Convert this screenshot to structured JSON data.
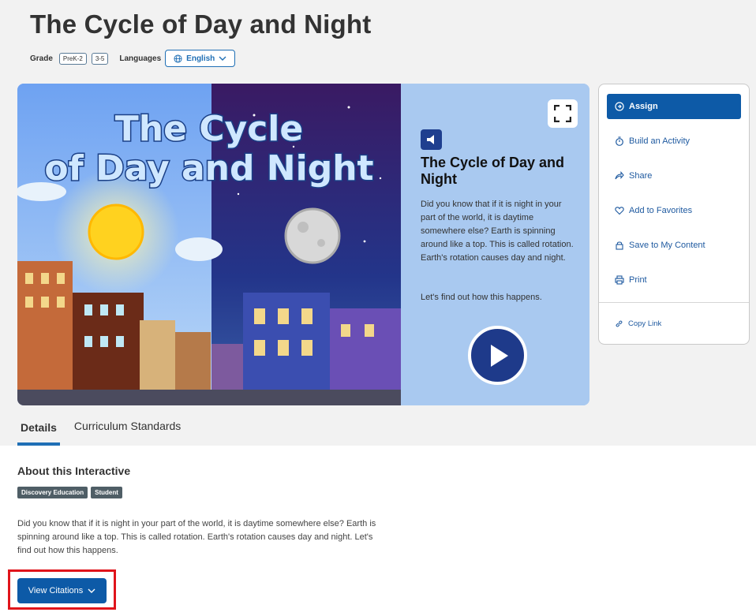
{
  "page": {
    "title": "The Cycle of Day and Night"
  },
  "meta": {
    "grade_label": "Grade",
    "grades": [
      "PreK-2",
      "3-5"
    ],
    "languages_label": "Languages",
    "language_selected": "English"
  },
  "hero": {
    "art_title_line1": "The Cycle",
    "art_title_line2": "of Day and Night",
    "panel_title": "The Cycle of Day and Night",
    "panel_description": "Did you know that if it is night in your part of the world, it is daytime somewhere else? Earth is spinning around like a top. This is called rotation. Earth's rotation causes day and night.",
    "panel_cta": "Let's find out how this happens."
  },
  "actions": {
    "assign": "Assign",
    "build_activity": "Build an Activity",
    "share": "Share",
    "favorites": "Add to Favorites",
    "save": "Save to My Content",
    "print": "Print",
    "copy_link": "Copy Link"
  },
  "tabs": [
    {
      "label": "Details"
    },
    {
      "label": "Curriculum Standards"
    }
  ],
  "about": {
    "title": "About this Interactive",
    "tags": [
      "Discovery Education",
      "Student"
    ],
    "description": "Did you know that if it is night in your part of the world, it is daytime somewhere else? Earth is spinning around like a top. This is called rotation. Earth's rotation causes day and night. Let's find out how this happens.",
    "citations_button": "View Citations"
  },
  "icons": [
    "globe-icon",
    "chevron-down-icon",
    "expand-icon",
    "speaker-icon",
    "play-icon",
    "arrow-circle-icon",
    "stopwatch-icon",
    "share-icon",
    "heart-icon",
    "lock-icon",
    "print-icon",
    "link-icon"
  ],
  "colors": {
    "primary": "#0d5aa7",
    "highlight": "#e0141b",
    "panel_bg": "#a9c9f0",
    "tag_bg": "#4f5e66"
  }
}
